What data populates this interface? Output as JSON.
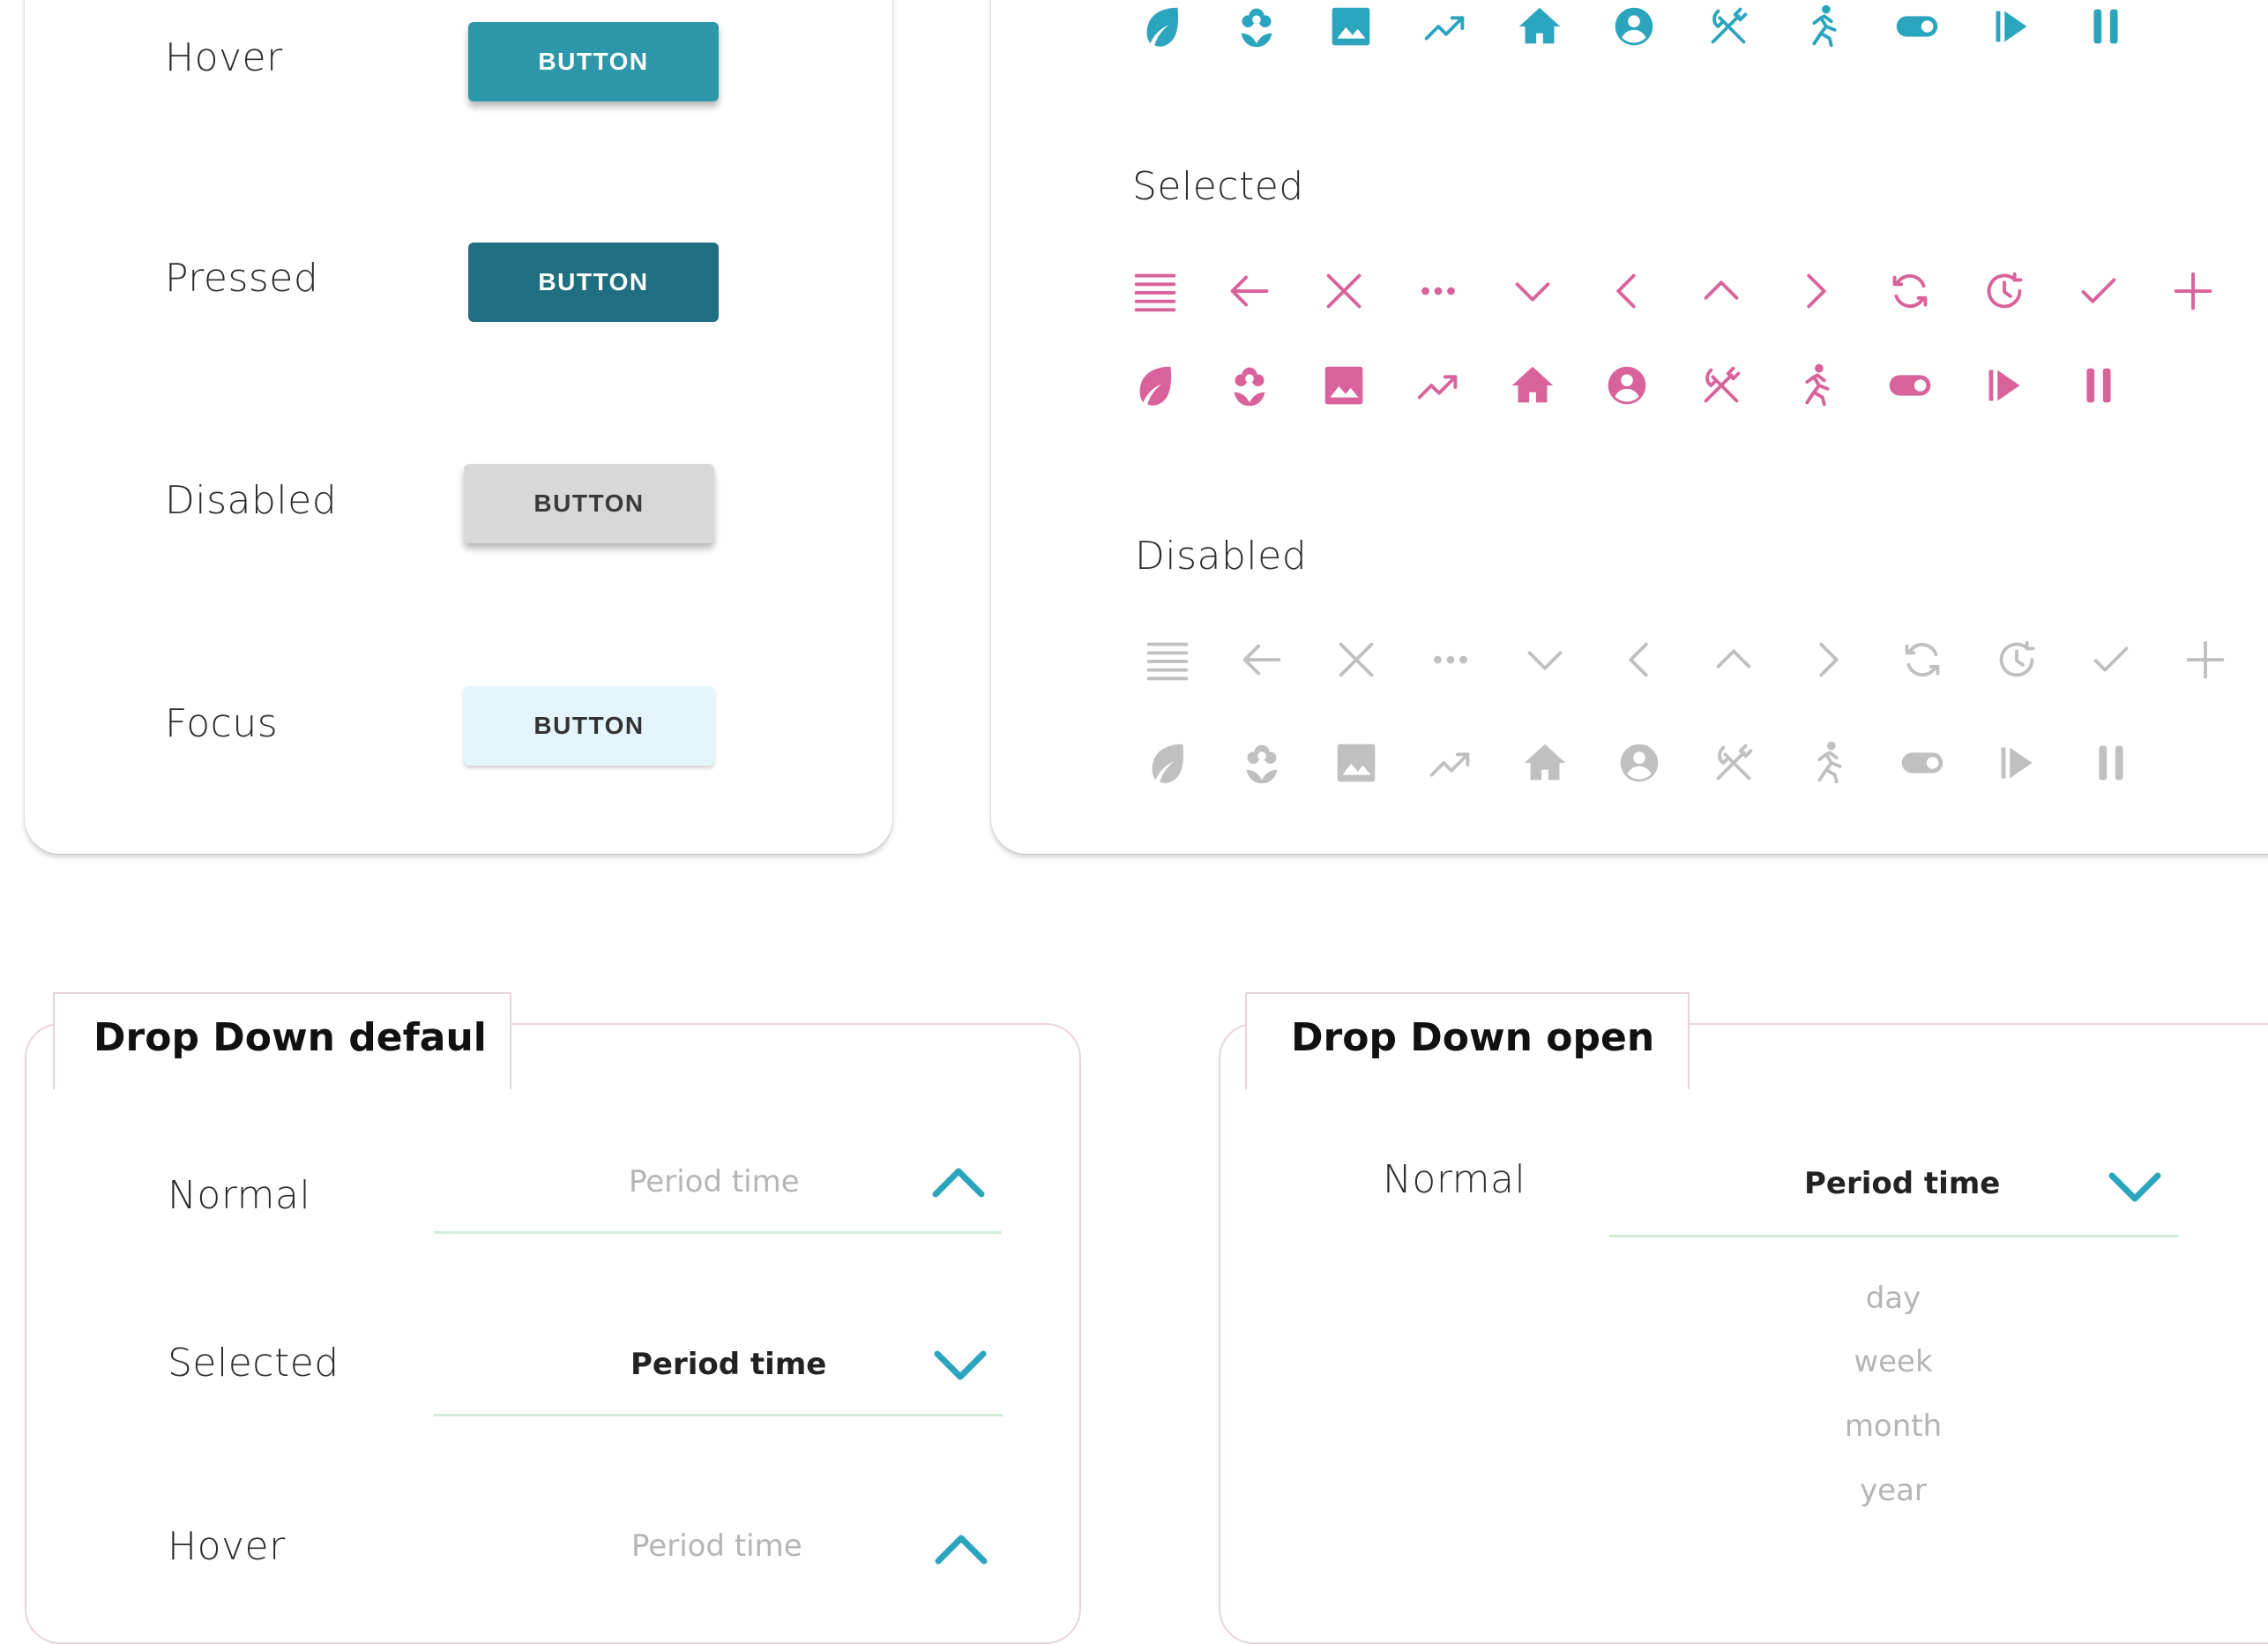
{
  "colors": {
    "hover_button": "#2b97a8",
    "pressed_button": "#1f6f80",
    "disabled_button": "#d8d8d8",
    "focus_button": "#e4f6fb",
    "icon_normal": "#2ba5be",
    "icon_selected": "#d9629a",
    "icon_disabled": "#c0c0c0",
    "chevron": "#2ba5be"
  },
  "button_states": {
    "hover": {
      "label": "Hover",
      "button": "BUTTON"
    },
    "pressed": {
      "label": "Pressed",
      "button": "BUTTON"
    },
    "disabled": {
      "label": "Disabled",
      "button": "BUTTON"
    },
    "focus": {
      "label": "Focus",
      "button": "BUTTON"
    }
  },
  "icons": {
    "selected_label": "Selected",
    "disabled_label": "Disabled",
    "row_a": [
      "menu-icon",
      "arrow-left-icon",
      "close-icon",
      "more-horizontal-icon",
      "chevron-down-icon",
      "chevron-left-icon",
      "chevron-up-icon",
      "chevron-right-icon",
      "refresh-icon",
      "history-icon",
      "check-icon",
      "plus-icon"
    ],
    "row_b": [
      "leaf-icon",
      "flower-icon",
      "image-icon",
      "trending-up-icon",
      "home-icon",
      "account-circle-icon",
      "cutlery-icon",
      "run-icon",
      "toggle-icon",
      "skip-play-icon",
      "pause-icon"
    ]
  },
  "dropdown_default": {
    "title": "Drop Down defaul",
    "normal": {
      "label": "Normal",
      "value": "Period time"
    },
    "selected": {
      "label": "Selected",
      "value": "Period time"
    },
    "hover": {
      "label": "Hover",
      "value": "Period time"
    }
  },
  "dropdown_open": {
    "title": "Drop Down open",
    "normal": {
      "label": "Normal",
      "value": "Period time"
    },
    "options": [
      "day",
      "week",
      "month",
      "year"
    ]
  }
}
